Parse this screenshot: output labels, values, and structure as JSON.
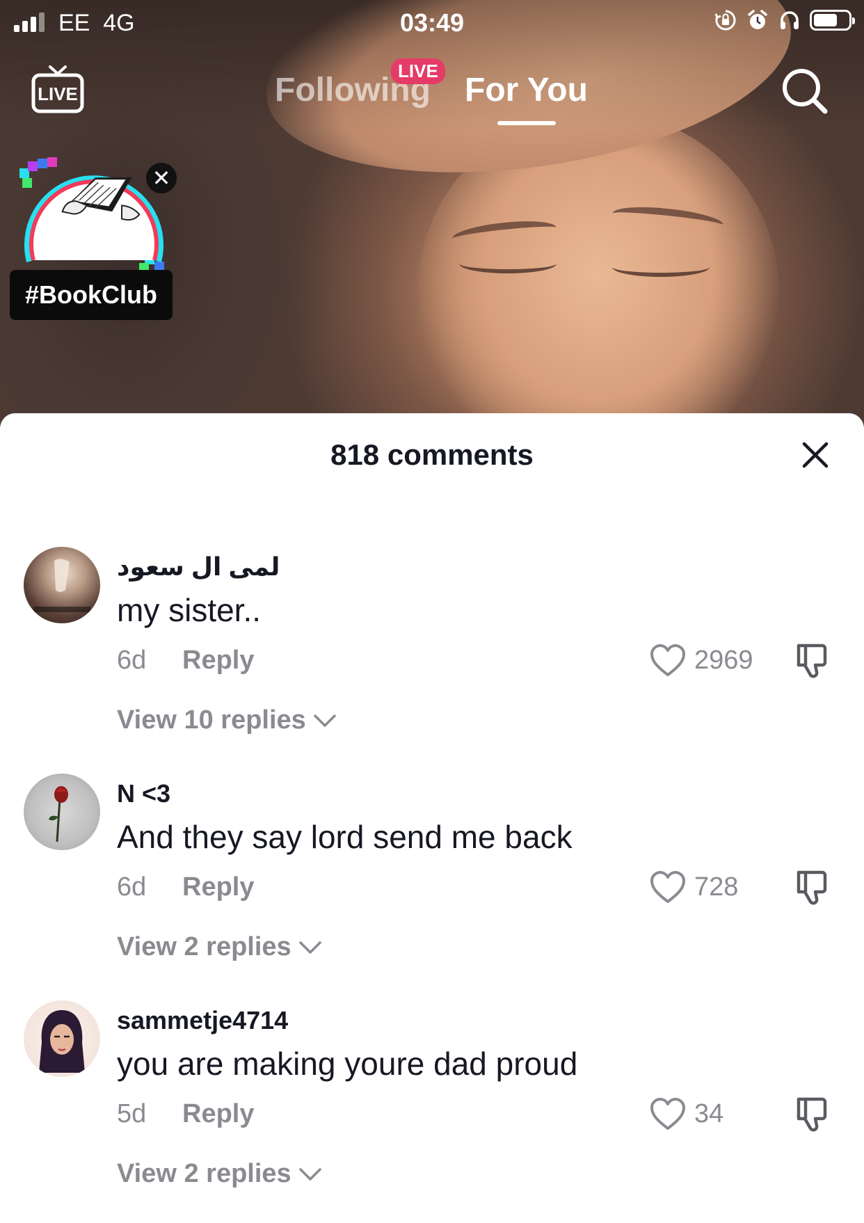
{
  "status_bar": {
    "carrier": "EE",
    "network": "4G",
    "time": "03:49",
    "battery_level": 0.62,
    "icons": [
      "signal-icon",
      "orientation-lock-icon",
      "alarm-icon",
      "headphones-icon",
      "battery-icon"
    ]
  },
  "top_nav": {
    "live_icon_label": "LIVE",
    "tabs": [
      {
        "label": "Following",
        "active": false,
        "badge": "LIVE"
      },
      {
        "label": "For You",
        "active": true
      }
    ],
    "search_icon": "search-icon"
  },
  "sticker": {
    "hashtag": "#BookClub"
  },
  "comments_panel": {
    "title": "818 comments",
    "comments": [
      {
        "username": "لمى ال سعود",
        "text": "my sister..",
        "age": "6d",
        "reply_label": "Reply",
        "likes": "2969",
        "view_replies": "View 10 replies"
      },
      {
        "username": "N <3",
        "text": "And they say lord send me back",
        "age": "6d",
        "reply_label": "Reply",
        "likes": "728",
        "view_replies": "View 2 replies"
      },
      {
        "username": "sammetje4714",
        "text": "you are making youre dad proud",
        "age": "5d",
        "reply_label": "Reply",
        "likes": "34",
        "view_replies": "View 2 replies"
      }
    ]
  },
  "colors": {
    "live_badge": "#e53b67",
    "text_primary": "#161823",
    "text_secondary": "#8a8b91"
  }
}
